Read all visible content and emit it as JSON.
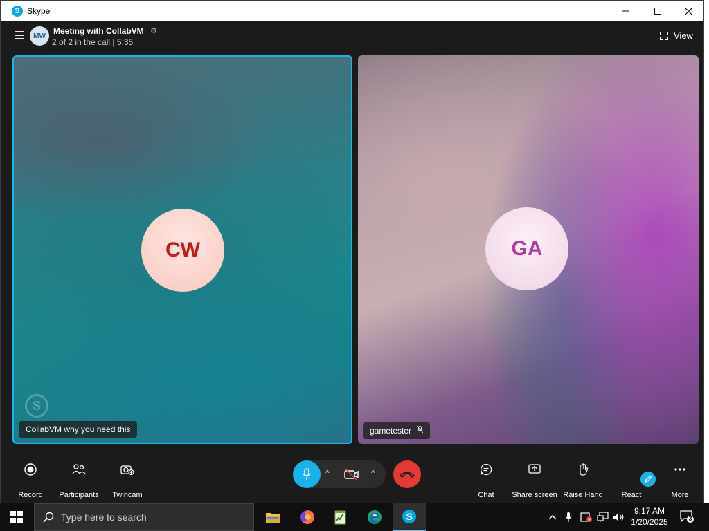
{
  "window": {
    "app_title": "Skype",
    "app_icon_letter": "S",
    "controls": {
      "minimize": "—",
      "maximize": "☐",
      "close": "✕"
    }
  },
  "header": {
    "avatar_initials": "MW",
    "meeting_title": "Meeting with CollabVM",
    "meeting_status": "2 of 2 in the call | 5:35",
    "view_label": "View"
  },
  "participants": [
    {
      "initials": "CW",
      "name_tag": "CollabVM why you need this",
      "muted": false,
      "speaking": true
    },
    {
      "initials": "GA",
      "name_tag": "gametester",
      "muted": true,
      "speaking": false
    }
  ],
  "controls": {
    "record": "Record",
    "participants": "Participants",
    "twincam": "Twincam",
    "chat": "Chat",
    "share_screen": "Share screen",
    "raise_hand": "Raise Hand",
    "react": "React",
    "more": "More"
  },
  "taskbar": {
    "search_placeholder": "Type here to search",
    "time": "9:17 AM",
    "date": "1/20/2025",
    "notification_count": "3",
    "apps": [
      "file-explorer",
      "firefox",
      "notepad-plus",
      "edge",
      "skype"
    ]
  },
  "colors": {
    "accent": "#17b3ea",
    "end_call": "#e53935",
    "cw_text": "#c4181b",
    "ga_text": "#b13aa5"
  }
}
